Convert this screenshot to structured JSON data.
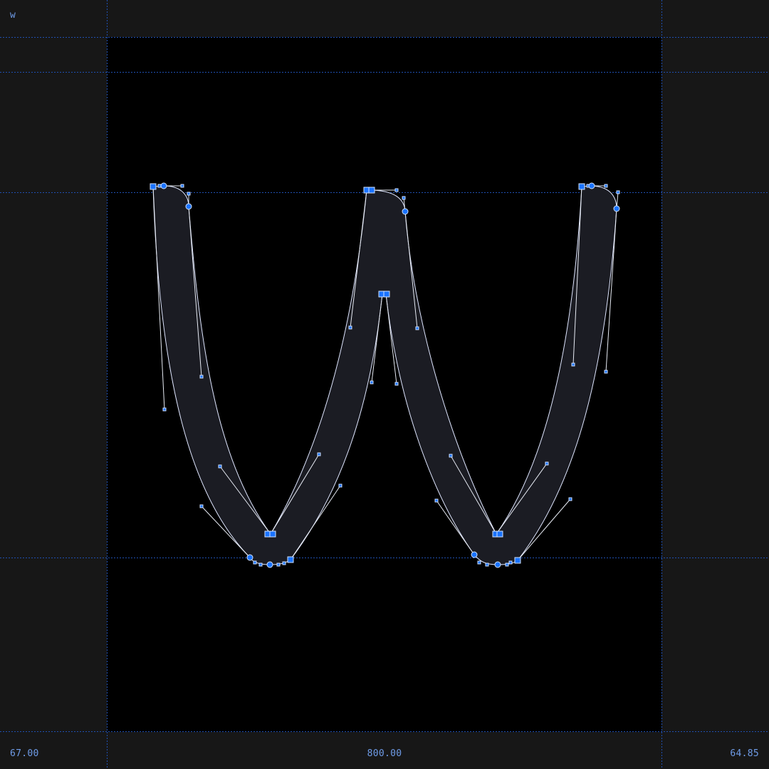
{
  "glyph": {
    "name": "w"
  },
  "metrics": {
    "left_sidebearing": "67.00",
    "advance_width": "800.00",
    "right_sidebearing": "64.85"
  },
  "colors": {
    "background": "#171717",
    "canvas": "#000000",
    "glyph_fill": "#1b1c23",
    "outline": "#dfe6ff",
    "guide": "#1f4fb0",
    "node": "#1a73ff",
    "handle": "#7fb0ff",
    "label": "#6f9ce8"
  }
}
